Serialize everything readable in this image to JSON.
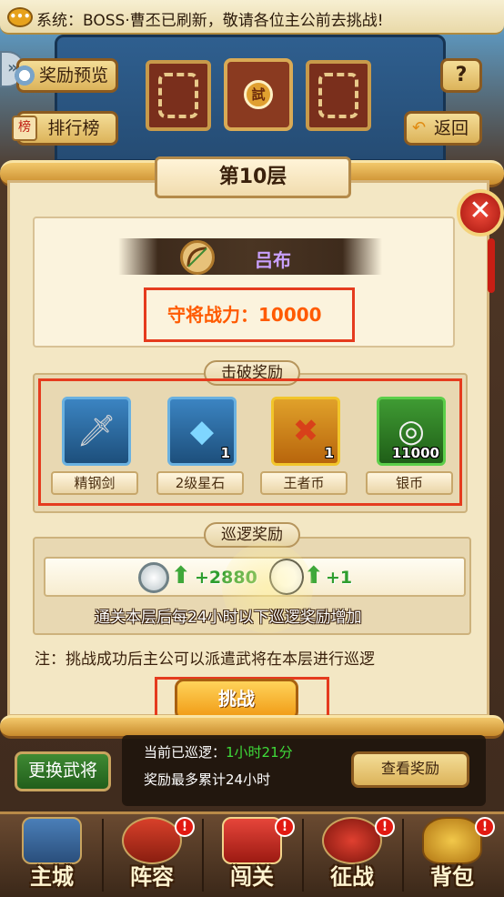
{
  "system_banner": {
    "text": "系统：BOSS·曹丕已刷新，敬请各位主公前去挑战!",
    "icon": "chat-bubble-icon"
  },
  "top_buttons": {
    "reward_preview": "奖励预览",
    "ranking": "排行榜",
    "help": "?",
    "back": "返回",
    "ranking_badge": "榜"
  },
  "tower": {
    "seal_glyph": "試"
  },
  "dialog": {
    "floor_title": "第10层",
    "boss_name": "吕布",
    "boss_power": "守将战力：10000",
    "close_glyph": "✕"
  },
  "defeat_rewards": {
    "title": "击破奖励",
    "items": [
      {
        "label": "精钢剑",
        "qty": "",
        "icon": "sword-icon"
      },
      {
        "label": "2级星石",
        "qty": "1",
        "icon": "blue-gem-icon"
      },
      {
        "label": "王者币",
        "qty": "1",
        "icon": "king-coin-icon"
      },
      {
        "label": "银币",
        "qty": "11000",
        "icon": "silver-coins-icon"
      }
    ]
  },
  "patrol_rewards": {
    "title": "巡逻奖励",
    "coin_bonus": "+2880",
    "panda_bonus": "+1",
    "note": "通关本层后每24小时以下巡逻奖励增加"
  },
  "note": "注：挑战成功后主公可以派遣武将在本层进行巡逻",
  "challenge_button": "挑战",
  "patrol_info": {
    "current_label": "当前已巡逻：",
    "current_value": "1小时21分",
    "max_text": "奖励最多累计24小时",
    "change_general": "更换武将",
    "view_reward": "查看奖励"
  },
  "bottom_nav": [
    {
      "label": "主城",
      "badge": "",
      "icon": "city-icon"
    },
    {
      "label": "阵容",
      "badge": "!",
      "icon": "lineup-icon"
    },
    {
      "label": "闯关",
      "badge": "!",
      "icon": "stage-scroll-icon"
    },
    {
      "label": "征战",
      "badge": "!",
      "icon": "crossed-swords-icon"
    },
    {
      "label": "背包",
      "badge": "!",
      "icon": "bag-icon"
    }
  ],
  "colors": {
    "highlight_box": "#e53b1e",
    "boss_power": "#ff5a00",
    "boss_name": "#c9a0ff",
    "bonus_green": "#2f9e2f"
  }
}
